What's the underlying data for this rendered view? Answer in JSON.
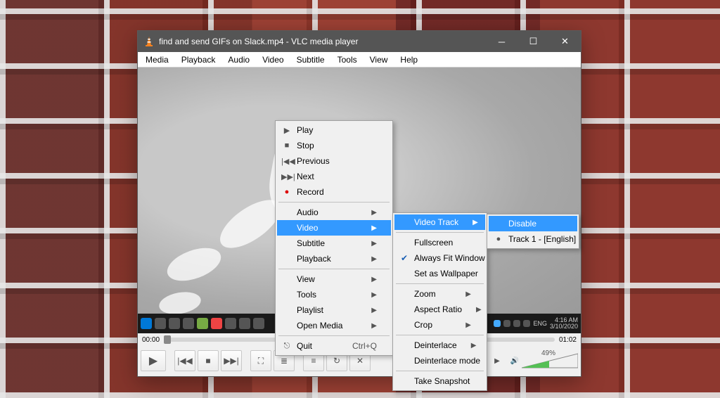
{
  "title": "find and send GIFs on Slack.mp4 - VLC media player",
  "menubar": [
    "Media",
    "Playback",
    "Audio",
    "Video",
    "Subtitle",
    "Tools",
    "View",
    "Help"
  ],
  "time": {
    "elapsed": "00:00",
    "total": "01:02"
  },
  "volume": {
    "percent_label": "49%"
  },
  "taskbar": {
    "lang": "ENG",
    "clock": "4:16 AM",
    "date": "3/10/2020"
  },
  "context_menu": {
    "items": [
      {
        "icon": "play",
        "label": "Play"
      },
      {
        "icon": "stop",
        "label": "Stop"
      },
      {
        "icon": "prev",
        "label": "Previous"
      },
      {
        "icon": "next",
        "label": "Next"
      },
      {
        "icon": "rec",
        "label": "Record"
      },
      {
        "sep": true
      },
      {
        "label": "Audio",
        "sub": true
      },
      {
        "label": "Video",
        "sub": true,
        "hl": true
      },
      {
        "label": "Subtitle",
        "sub": true
      },
      {
        "label": "Playback",
        "sub": true
      },
      {
        "sep": true
      },
      {
        "label": "View",
        "sub": true
      },
      {
        "label": "Tools",
        "sub": true
      },
      {
        "label": "Playlist",
        "sub": true
      },
      {
        "label": "Open Media",
        "sub": true
      },
      {
        "sep": true
      },
      {
        "icon": "quit",
        "label": "Quit",
        "shortcut": "Ctrl+Q"
      }
    ]
  },
  "video_submenu": {
    "items": [
      {
        "label": "Video Track",
        "sub": true,
        "hl": true
      },
      {
        "sep": true
      },
      {
        "label": "Fullscreen"
      },
      {
        "label": "Always Fit Window",
        "checked": true
      },
      {
        "label": "Set as Wallpaper"
      },
      {
        "sep": true
      },
      {
        "label": "Zoom",
        "sub": true
      },
      {
        "label": "Aspect Ratio",
        "sub": true
      },
      {
        "label": "Crop",
        "sub": true
      },
      {
        "sep": true
      },
      {
        "label": "Deinterlace",
        "sub": true
      },
      {
        "label": "Deinterlace mode",
        "sub": true
      },
      {
        "sep": true
      },
      {
        "label": "Take Snapshot"
      }
    ]
  },
  "track_submenu": {
    "items": [
      {
        "label": "Disable",
        "hl": true
      },
      {
        "label": "Track 1 - [English]",
        "radio": true
      }
    ]
  }
}
